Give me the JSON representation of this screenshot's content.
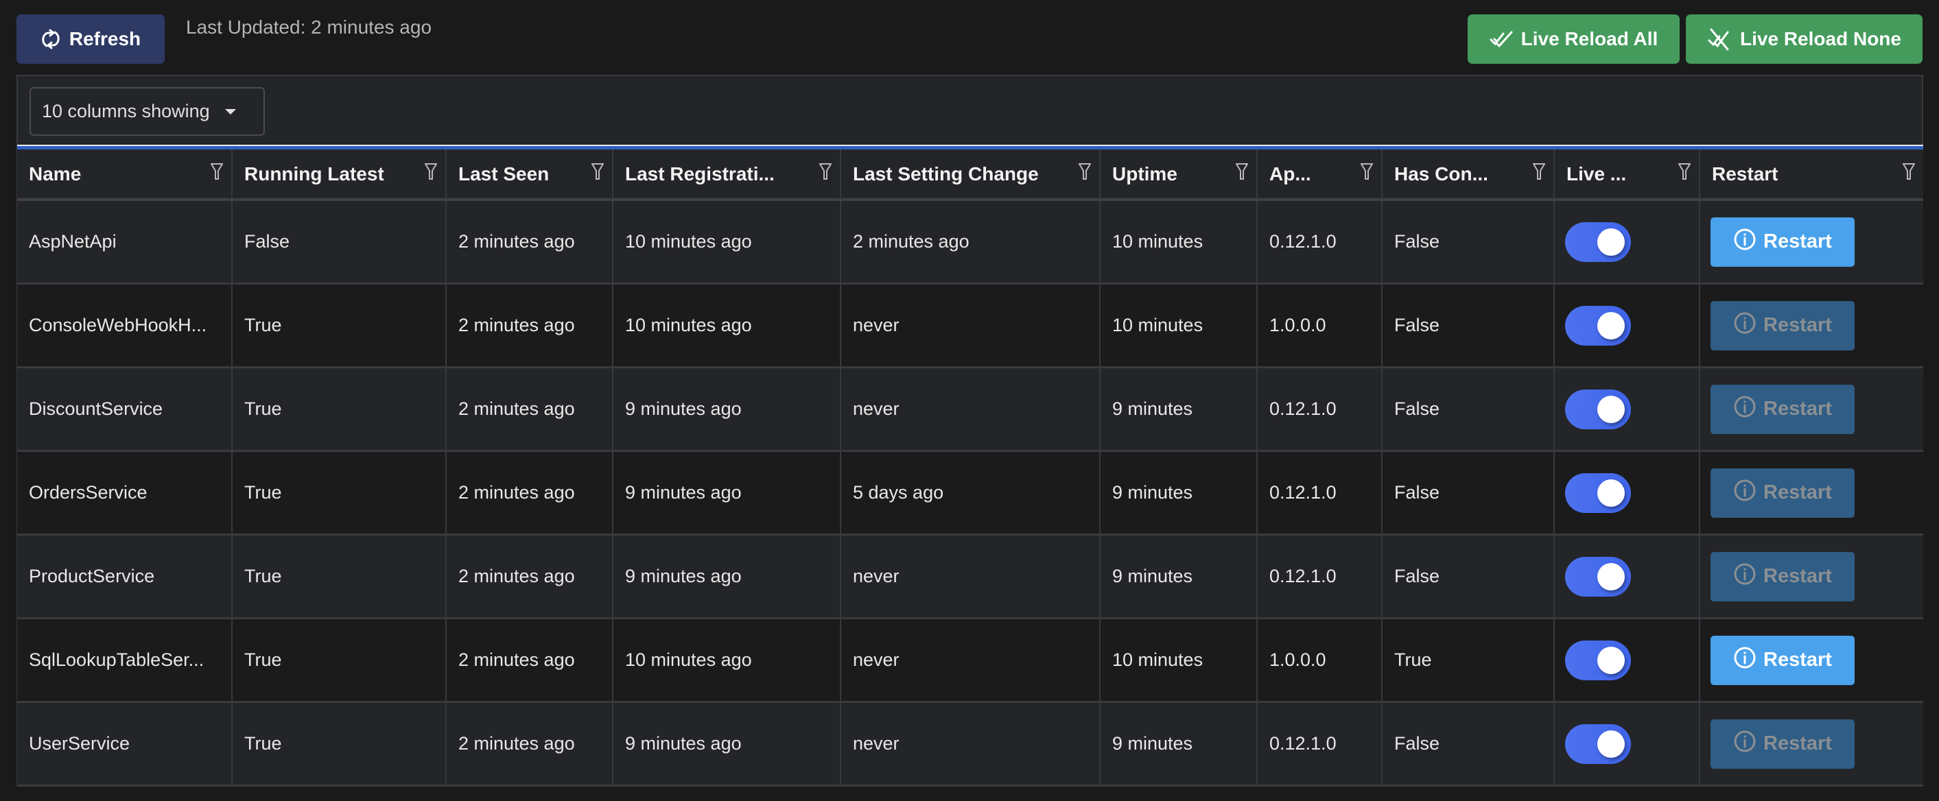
{
  "toolbar": {
    "refresh_label": "Refresh",
    "refresh_icon": "sync-icon",
    "last_updated": "Last Updated: 2 minutes ago",
    "live_reload_all_label": "Live Reload All",
    "live_reload_all_icon": "double-check-icon",
    "live_reload_none_label": "Live Reload None",
    "live_reload_none_icon": "double-check-slash-icon"
  },
  "colors": {
    "refresh_button": "#2e3a64",
    "live_reload_button": "#459b5c",
    "restart_enabled": "#4aa2ec",
    "restart_disabled": "#2f5d85",
    "toggle_on": "#4a6ced",
    "header_accent": "#2f5fc4"
  },
  "grid": {
    "columns_dropdown_label": "10 columns showing",
    "columns": [
      {
        "key": "name",
        "label": "Name"
      },
      {
        "key": "running_latest",
        "label": "Running Latest"
      },
      {
        "key": "last_seen",
        "label": "Last Seen"
      },
      {
        "key": "last_registration",
        "label": "Last Registrati..."
      },
      {
        "key": "last_setting_change",
        "label": "Last Setting Change"
      },
      {
        "key": "uptime",
        "label": "Uptime"
      },
      {
        "key": "app_version",
        "label": "Ap..."
      },
      {
        "key": "has_config",
        "label": "Has Con..."
      },
      {
        "key": "live_reload",
        "label": "Live ..."
      },
      {
        "key": "restart",
        "label": "Restart"
      }
    ],
    "restart_label": "Restart",
    "rows": [
      {
        "name": "AspNetApi",
        "running_latest": "False",
        "last_seen": "2 minutes ago",
        "last_registration": "10 minutes ago",
        "last_setting_change": "2 minutes ago",
        "uptime": "10 minutes",
        "app_version": "0.12.1.0",
        "has_config": "False",
        "live_reload": true,
        "restart_enabled": true
      },
      {
        "name": "ConsoleWebHookH...",
        "running_latest": "True",
        "last_seen": "2 minutes ago",
        "last_registration": "10 minutes ago",
        "last_setting_change": "never",
        "uptime": "10 minutes",
        "app_version": "1.0.0.0",
        "has_config": "False",
        "live_reload": true,
        "restart_enabled": false
      },
      {
        "name": "DiscountService",
        "running_latest": "True",
        "last_seen": "2 minutes ago",
        "last_registration": "9 minutes ago",
        "last_setting_change": "never",
        "uptime": "9 minutes",
        "app_version": "0.12.1.0",
        "has_config": "False",
        "live_reload": true,
        "restart_enabled": false
      },
      {
        "name": "OrdersService",
        "running_latest": "True",
        "last_seen": "2 minutes ago",
        "last_registration": "9 minutes ago",
        "last_setting_change": "5 days ago",
        "uptime": "9 minutes",
        "app_version": "0.12.1.0",
        "has_config": "False",
        "live_reload": true,
        "restart_enabled": false
      },
      {
        "name": "ProductService",
        "running_latest": "True",
        "last_seen": "2 minutes ago",
        "last_registration": "9 minutes ago",
        "last_setting_change": "never",
        "uptime": "9 minutes",
        "app_version": "0.12.1.0",
        "has_config": "False",
        "live_reload": true,
        "restart_enabled": false
      },
      {
        "name": "SqlLookupTableSer...",
        "running_latest": "True",
        "last_seen": "2 minutes ago",
        "last_registration": "10 minutes ago",
        "last_setting_change": "never",
        "uptime": "10 minutes",
        "app_version": "1.0.0.0",
        "has_config": "True",
        "live_reload": true,
        "restart_enabled": true
      },
      {
        "name": "UserService",
        "running_latest": "True",
        "last_seen": "2 minutes ago",
        "last_registration": "9 minutes ago",
        "last_setting_change": "never",
        "uptime": "9 minutes",
        "app_version": "0.12.1.0",
        "has_config": "False",
        "live_reload": true,
        "restart_enabled": false
      }
    ]
  }
}
